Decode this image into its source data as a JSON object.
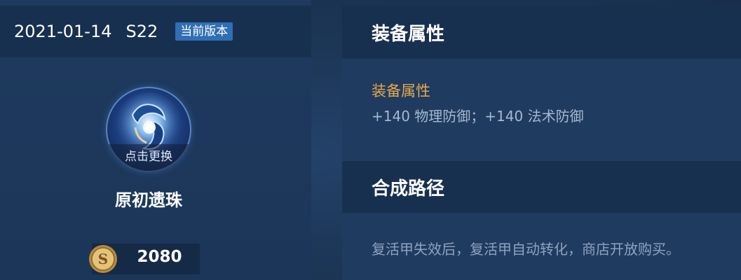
{
  "version": {
    "date": "2021-01-14",
    "season": "S22",
    "badge": "当前版本"
  },
  "item": {
    "icon": "primordial-orb-icon",
    "change_label": "点击更换",
    "name": "原初遗珠",
    "price": "2080",
    "currency_icon": "gold-coin-icon"
  },
  "attributes": {
    "header": "装备属性",
    "subtitle": "装备属性",
    "text": "+140 物理防御；+140 法术防御"
  },
  "craft_path": {
    "header": "合成路径",
    "text": "复活甲失效后，复活甲自动转化，商店开放购买。"
  },
  "colors": {
    "background": "#1b3455",
    "header_band": "#18304f",
    "badge": "#2f6fb4",
    "subtitle_gold": "#e8a94a",
    "body_text": "#a7b8d0"
  }
}
